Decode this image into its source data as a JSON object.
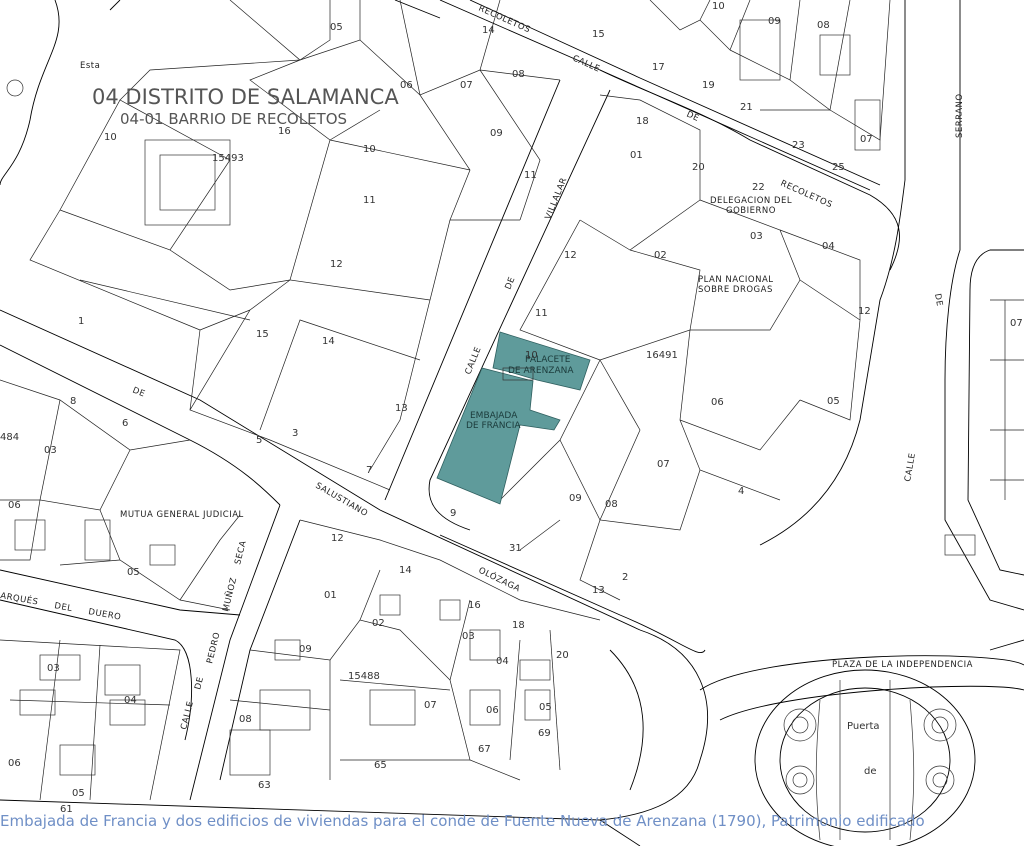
{
  "map": {
    "district_title": "04 DISTRITO DE SALAMANCA",
    "barrio_title": "04-01 BARRIO DE RECOLETOS",
    "highlight_color": "#5f9b9b",
    "buildings": {
      "embajada": "EMBAJADA DE FRANCIA",
      "palacete_1": "PALACETE",
      "palacete_2": "DE ARENZANA",
      "delegacion": "DELEGACION DEL GOBIERNO",
      "plan": "PLAN NACIONAL SOBRE DROGAS",
      "mutua": "MUTUA GENERAL JUDICIAL",
      "plaza": "PLAZA DE LA INDEPENDENCIA",
      "puerta": "Puerta",
      "de": "de"
    },
    "streets": {
      "recoletos": "RECOLETOS",
      "calle": "CALLE",
      "de": "DE",
      "recoletos_de": "RECOLETOS",
      "serrano": "SERRANO",
      "villalar": "VILLALAR",
      "calle_villalar": "CALLE",
      "de_villalar": "DE",
      "salustiano": "SALUSTIANO",
      "olozaga": "OLÓZAGA",
      "marques": "ARQUÉS",
      "del": "DEL",
      "duero": "DUERO",
      "de_w": "DE",
      "seca": "SECA",
      "munoz": "MUÑOZ",
      "pedro": "PEDRO",
      "de_p": "DE",
      "calle_p": "CALLE",
      "calle_e": "CALLE",
      "de_e": "DE",
      "esta": "Esta",
      "calle_bottom": "CALLE"
    },
    "lot_labels": {
      "l05a": "05",
      "l06a": "06",
      "l07a": "07",
      "l08a": "08",
      "l09a": "09",
      "l10a": "10",
      "l16": "16",
      "l15493": "15493",
      "l11a": "11",
      "l12a": "12",
      "l15": "15",
      "l14": "14",
      "l13": "13",
      "l10b": "10",
      "l09b": "09",
      "l08b": "08",
      "l07b": "07",
      "l01a": "01",
      "l02a": "02",
      "l03a": "03",
      "l04a": "04",
      "l12b": "12",
      "l11b": "11",
      "l10c": "10",
      "l16491": "16491",
      "l06b": "06",
      "l05b": "05",
      "l07c": "07",
      "l08c": "08",
      "l09c": "09",
      "l484": "484",
      "l03b": "03",
      "l06c": "06",
      "l05c": "05",
      "l12c": "12",
      "l14b": "14",
      "l01b": "01",
      "l02b": "02",
      "l03c": "03",
      "l04b": "04",
      "l09d": "09",
      "l15488": "15488",
      "l07d": "07",
      "l06d": "06",
      "l05d": "05",
      "l08d": "08",
      "l03d": "03",
      "l04c": "04",
      "l06e": "06",
      "l05e": "05",
      "l07e": "07"
    },
    "small_numbers": {
      "n14": "14",
      "n15": "15",
      "n17": "17",
      "n19": "19",
      "n21": "21",
      "n23": "23",
      "n25": "25",
      "n18": "18",
      "n22": "22",
      "n20": "20",
      "n9": "9",
      "n31": "31",
      "n13": "13",
      "n1": "1",
      "n3": "3",
      "n5": "5",
      "n7": "7",
      "n11": "11",
      "n16": "16",
      "n18b": "18",
      "n20b": "20",
      "n69": "69",
      "n67": "67",
      "n65": "65",
      "n63": "63",
      "n61": "61",
      "n2": "2",
      "n4": "4",
      "n6": "6",
      "n8": "8",
      "n10": "10",
      "n12": "12"
    }
  },
  "caption": "Embajada de Francia y dos edificios de viviendas para el conde de Fuente Nueva de Arenzana (1790), Patrimonio edificado"
}
